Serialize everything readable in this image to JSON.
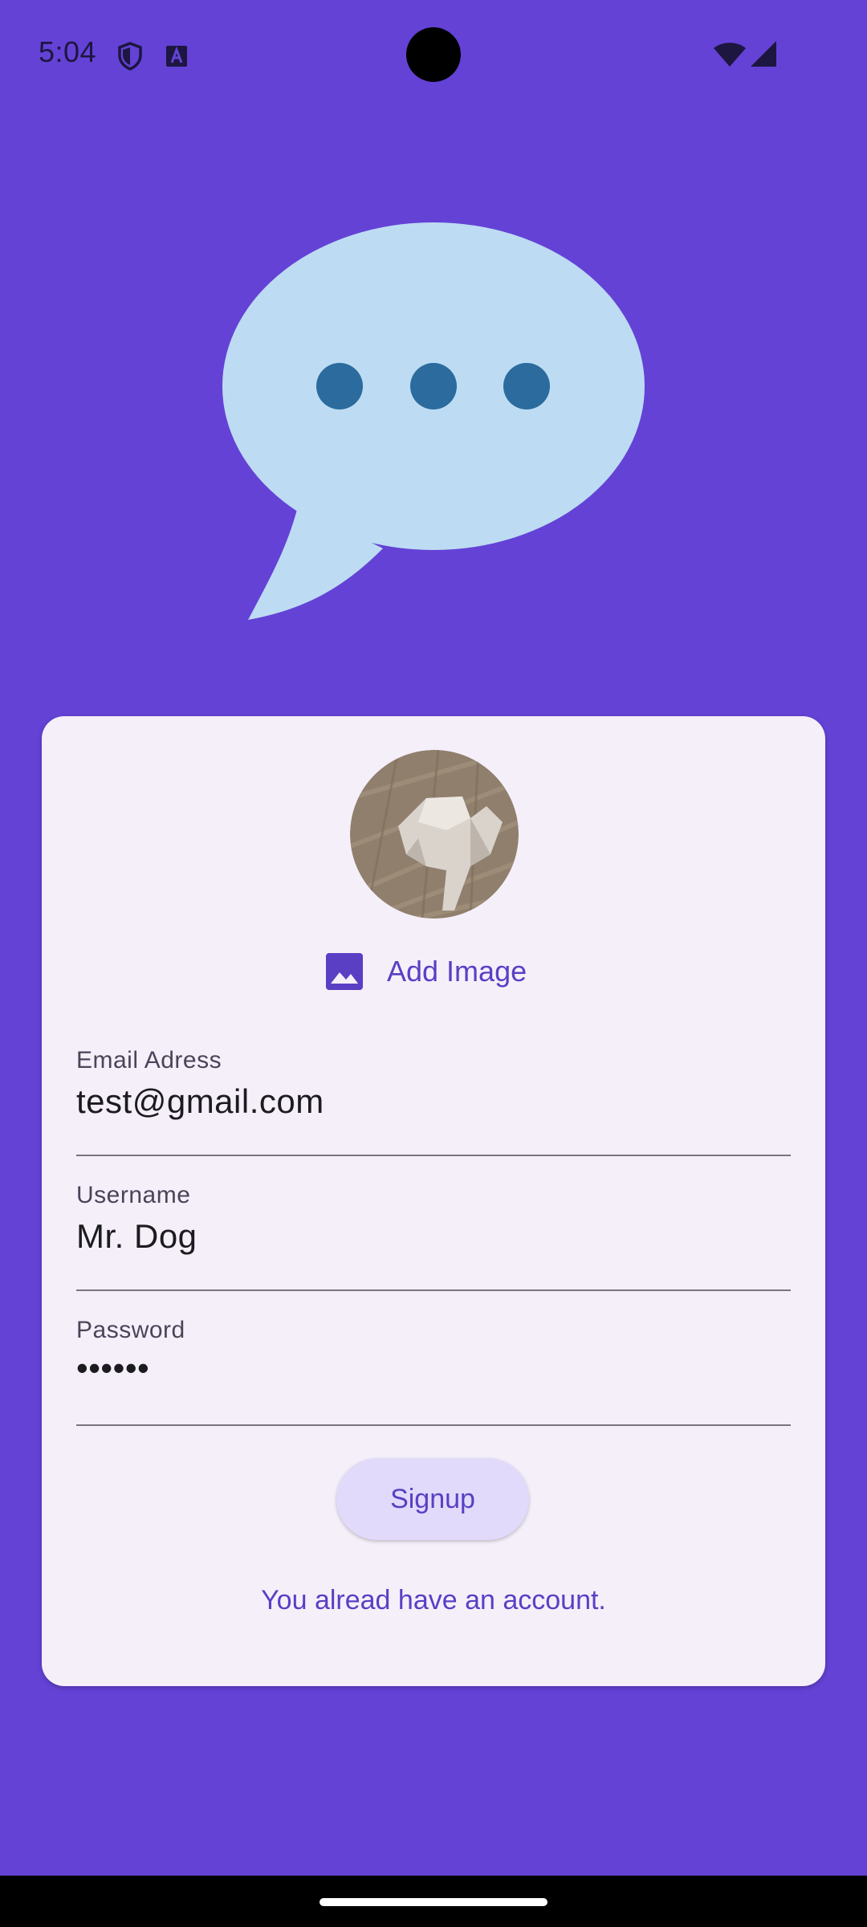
{
  "status_bar": {
    "time": "5:04",
    "icons": [
      "shield-icon",
      "text-a-icon",
      "wifi-icon",
      "cellular-icon"
    ]
  },
  "hero": {
    "icon": "chat-bubble-icon",
    "bubble_color": "#bddcf3",
    "dot_color": "#2b6b9e"
  },
  "signup_card": {
    "avatar": "avatar-image",
    "add_image_label": "Add Image",
    "fields": [
      {
        "label": "Email Adress",
        "value": "test@gmail.com"
      },
      {
        "label": "Username",
        "value": "Mr. Dog"
      },
      {
        "label": "Password",
        "value": "••••••"
      }
    ],
    "signup_label": "Signup",
    "login_link": "You alread have an account."
  },
  "colors": {
    "background": "#6442d6",
    "card": "#f5effa",
    "accent": "#5a3fc4",
    "button_bg": "#e1dafa"
  }
}
